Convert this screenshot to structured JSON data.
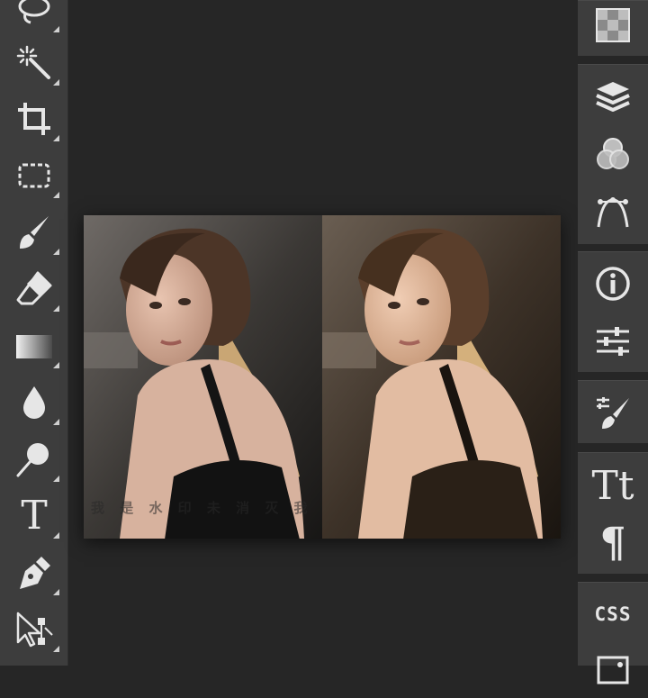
{
  "left_toolbar": {
    "tools": [
      {
        "icon": "lasso-icon"
      },
      {
        "icon": "magic-wand-icon"
      },
      {
        "icon": "crop-icon"
      },
      {
        "icon": "marquee-select-icon"
      },
      {
        "icon": "brush-icon"
      },
      {
        "icon": "eraser-icon"
      },
      {
        "icon": "gradient-icon"
      },
      {
        "icon": "blur-drop-icon"
      },
      {
        "icon": "dodge-icon"
      },
      {
        "icon": "text-icon",
        "label": "T"
      },
      {
        "icon": "pen-icon"
      },
      {
        "icon": "direct-select-icon"
      }
    ]
  },
  "canvas": {
    "watermark": "我 是 水 印 未 消 灭 我"
  },
  "right_panel": {
    "buttons": [
      {
        "icon": "swatches-icon"
      },
      {
        "icon": "layers-icon"
      },
      {
        "icon": "channels-icon"
      },
      {
        "icon": "paths-icon"
      },
      {
        "icon": "info-icon"
      },
      {
        "icon": "adjustments-icon"
      },
      {
        "icon": "brush-settings-icon"
      },
      {
        "icon": "character-icon",
        "label": "Tt"
      },
      {
        "icon": "paragraph-icon",
        "label": "¶"
      },
      {
        "icon": "css-icon",
        "label": "CSS"
      },
      {
        "icon": "image-icon"
      }
    ]
  },
  "colors": {
    "toolbar_bg": "#3d3d3d",
    "canvas_bg": "#262626",
    "icon": "#e6e6e6"
  }
}
